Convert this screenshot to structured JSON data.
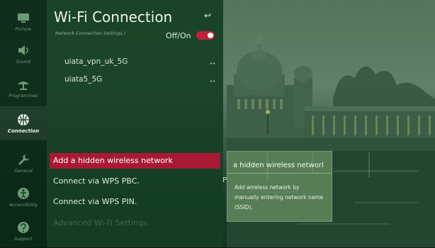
{
  "sidebar": {
    "items": [
      {
        "label": "Picture",
        "icon": "tv-icon",
        "active": false
      },
      {
        "label": "Sound",
        "icon": "speaker-icon",
        "active": false
      },
      {
        "label": "Programmes",
        "icon": "satellite-dish-icon",
        "active": false
      },
      {
        "label": "Connection",
        "icon": "globe-icon",
        "active": true
      },
      {
        "label": "General",
        "icon": "wrench-icon",
        "active": false
      },
      {
        "label": "Accessibility",
        "icon": "accessibility-icon",
        "active": false
      },
      {
        "label": "Support",
        "icon": "support-icon",
        "active": false
      }
    ]
  },
  "header": {
    "title": "Wi-Fi Connection",
    "breadcrumb": "Network Connection Settings /",
    "back_icon": "back-arrow-icon",
    "toggle_label": "Off/On",
    "toggle_on": true
  },
  "networks": [
    {
      "name": "uiata_vpn_uk_5G",
      "signal": "wifi-lock-icon"
    },
    {
      "name": "uiata5_5G",
      "signal": "wifi-lock-icon"
    }
  ],
  "menu": {
    "items": [
      {
        "label": "Add a hidden wireless network",
        "selected": true
      },
      {
        "label": "Connect via WPS PBC.",
        "selected": false
      },
      {
        "label": "Connect via WPS PIN.",
        "selected": false
      },
      {
        "label": "Advanced Wi-Fi Settings",
        "selected": false,
        "faded": true
      }
    ]
  },
  "tooltip": {
    "heading": "a hidden wireless networl",
    "body": "Add wireless network by manually entering network name (SSID)."
  },
  "colors": {
    "accent_selected": "#a81a34",
    "toggle_on": "#c0203a",
    "panel_bg": "#143e23"
  }
}
